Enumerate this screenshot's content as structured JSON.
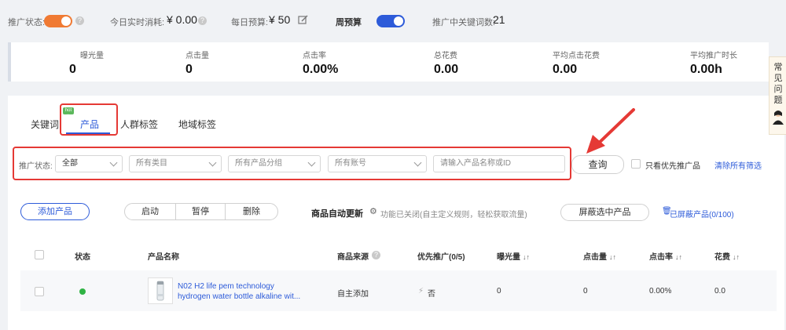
{
  "topbar": {
    "promo_status_label": "推广状态:",
    "today_spend_label": "今日实时消耗:",
    "today_spend_value": "¥ 0.00",
    "daily_budget_label": "每日预算:",
    "daily_budget_value": "¥ 50",
    "weekly_budget_label": "周预算",
    "keyword_count_label": "推广中关键词数:",
    "keyword_count_value": "21",
    "accent_orange": "#f07a33",
    "accent_blue": "#2d5bd9"
  },
  "stats": [
    {
      "label": "曝光量",
      "value": "0"
    },
    {
      "label": "点击量",
      "value": "0"
    },
    {
      "label": "点击率",
      "value": "0.00%"
    },
    {
      "label": "总花费",
      "value": "0.00"
    },
    {
      "label": "平均点击花费",
      "value": "0.00"
    },
    {
      "label": "平均推广时长",
      "value": "0.00h"
    }
  ],
  "side_helper": {
    "text": "常见问题"
  },
  "tabs": [
    {
      "label": "关键词"
    },
    {
      "label": "产品",
      "badge": "hot位"
    },
    {
      "label": "人群标签"
    },
    {
      "label": "地域标签"
    }
  ],
  "filters": {
    "status_label": "推广状态:",
    "status_value": "全部",
    "category_placeholder": "所有类目",
    "group_placeholder": "所有产品分组",
    "account_placeholder": "所有账号",
    "search_placeholder": "请输入产品名称或ID",
    "query_button": "查询",
    "priority_only_label": "只看优先推广品",
    "clear_filters": "清除所有筛选"
  },
  "actions": {
    "add_product": "添加产品",
    "start": "启动",
    "pause": "暂停",
    "delete": "删除",
    "auto_update_label": "商品自动更新",
    "auto_update_desc": "功能已关闭(自主定义规则，轻松获取流量)",
    "hide_selected": "屏蔽选中产品",
    "hidden_products": "已屏蔽产品(0/100)"
  },
  "table": {
    "headers": {
      "status": "状态",
      "name": "产品名称",
      "source": "商品来源",
      "priority": "优先推广(0/5)",
      "impressions": "曝光量",
      "clicks": "点击量",
      "ctr": "点击率",
      "cost": "花费"
    },
    "rows": [
      {
        "name_line1": "N02 H2 life pem technology",
        "name_line2": "hydrogen water bottle alkaline wit...",
        "source": "自主添加",
        "priority": "否",
        "impressions": "0",
        "clicks": "0",
        "ctr": "0.00%",
        "cost": "0.0"
      }
    ]
  }
}
